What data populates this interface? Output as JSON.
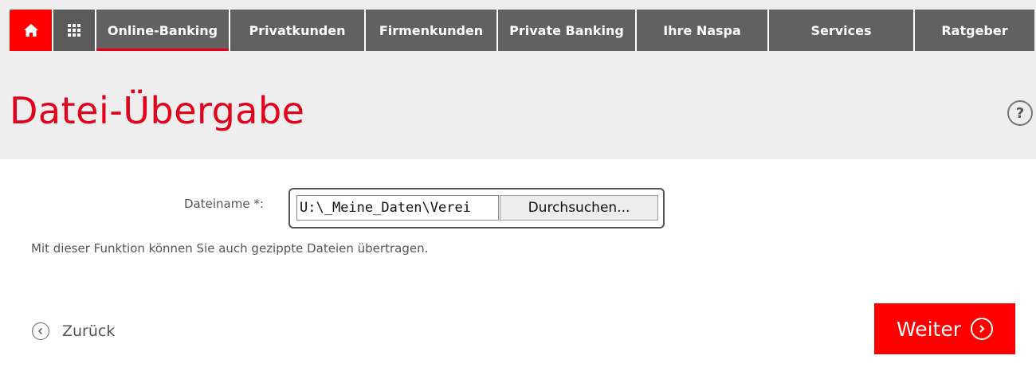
{
  "nav": {
    "home_icon": "home-icon",
    "apps_icon": "grid-icon",
    "items": [
      {
        "label": "Online-Banking",
        "active": true
      },
      {
        "label": "Privatkunden",
        "active": false
      },
      {
        "label": "Firmenkunden",
        "active": false
      },
      {
        "label": "Private Banking",
        "active": false
      },
      {
        "label": "Ihre Naspa",
        "active": false
      },
      {
        "label": "Services",
        "active": false
      },
      {
        "label": "Ratgeber",
        "active": false
      }
    ]
  },
  "page": {
    "title": "Datei-Übergabe",
    "help_label": "?"
  },
  "form": {
    "filename_label": "Dateiname *:",
    "file_path_value": "U:\\_Meine_Daten\\Verei",
    "browse_label": "Durchsuchen...",
    "hint": "Mit dieser Funktion können Sie auch gezippte Dateien übertragen."
  },
  "actions": {
    "back_label": "Zurück",
    "next_label": "Weiter"
  },
  "colors": {
    "brand_red": "#ff0000",
    "nav_grey": "#616161",
    "title_red": "#e2001a",
    "band_grey": "#eeeeee"
  }
}
